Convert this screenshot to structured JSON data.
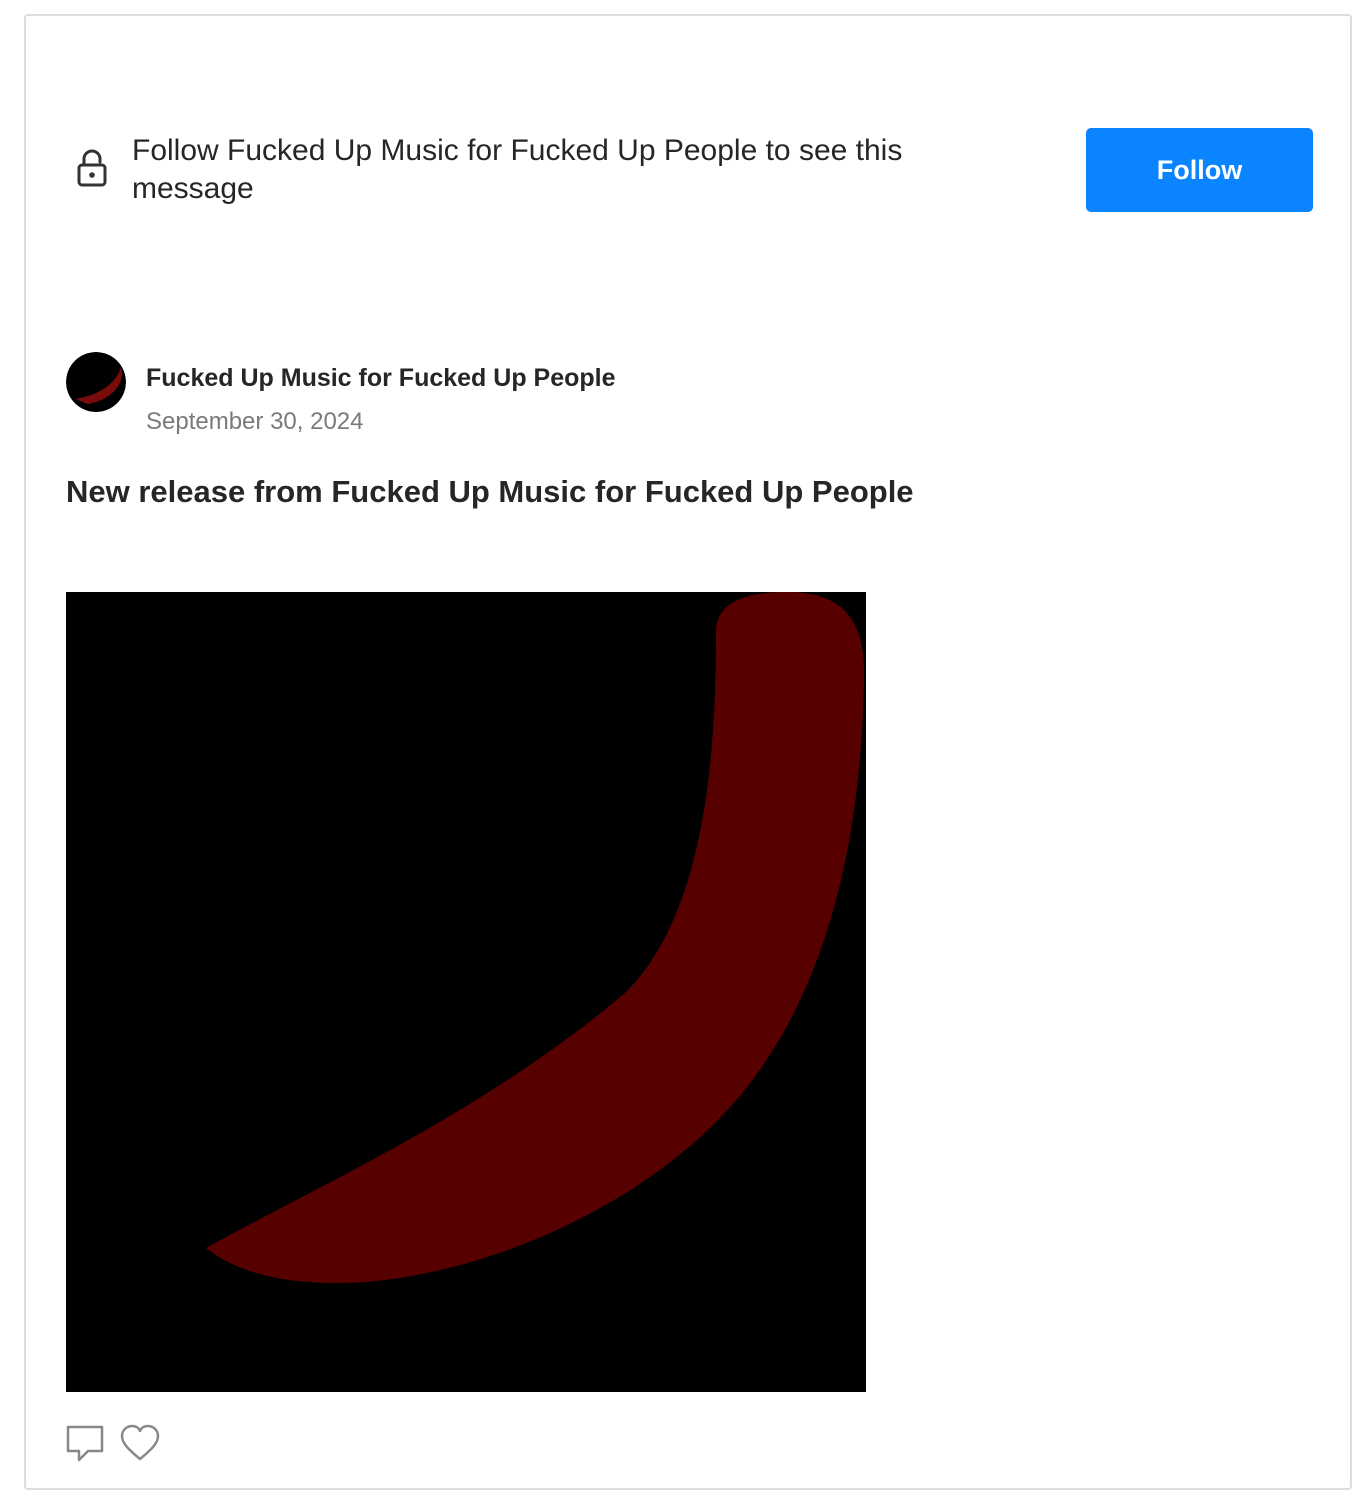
{
  "locked_notice": {
    "message": "Follow Fucked Up Music for Fucked Up People to see this message",
    "icon": "lock-icon",
    "follow_label": "Follow",
    "follow_color": "#0a84ff"
  },
  "post": {
    "author_name": "Fucked Up Music for Fucked Up People",
    "date": "September 30, 2024",
    "title": "New release from Fucked Up Music for Fucked Up People",
    "artwork_colors": {
      "background": "#000000",
      "stroke": "#560000"
    }
  },
  "actions": {
    "comment_icon": "comment-icon",
    "like_icon": "heart-icon"
  }
}
